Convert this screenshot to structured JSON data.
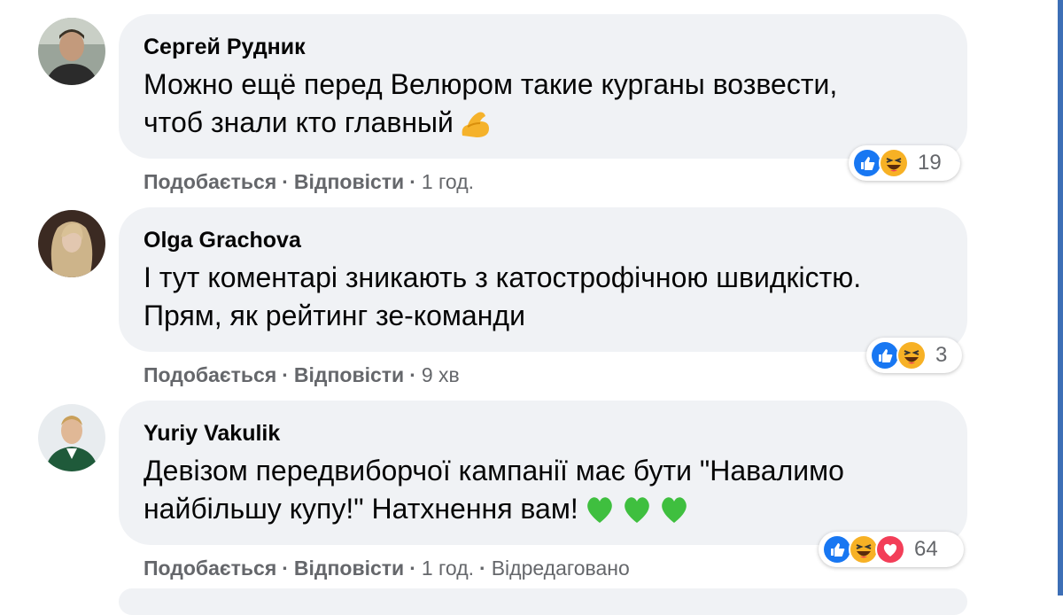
{
  "colors": {
    "bubble": "#f0f2f5",
    "meta_text": "#65676b",
    "like_blue": "#1877f2",
    "haha_yellow": "#f7b125",
    "love_red": "#f33e58",
    "frame": "#3d6fb6"
  },
  "comments": [
    {
      "author": "Сергей Рудник",
      "line1": "Можно ещё перед Велюром такие курганы возвести,",
      "line2": "чтоб знали кто главный",
      "trailing_emoji": "flexed-biceps-icon",
      "reactions": [
        "like-icon",
        "haha-icon"
      ],
      "reaction_count": "19",
      "like_label": "Подобається",
      "reply_label": "Відповісти",
      "time": "1 год.",
      "edited": ""
    },
    {
      "author": "Olga Grachova",
      "line1": "І тут коментарі зникають з катострофічною швидкістю.",
      "line2": "Прям, як рейтинг зе-команди",
      "reactions": [
        "like-icon",
        "haha-icon"
      ],
      "reaction_count": "3",
      "like_label": "Подобається",
      "reply_label": "Відповісти",
      "time": "9 хв",
      "edited": ""
    },
    {
      "author": "Yuriy Vakulik",
      "line1": "Девізом передвиборчої кампанії має бути \"Навалимо",
      "line2": "найбільшу купу!\" Натхнення вам!",
      "trailing_emoji": "green-heart-icon",
      "reactions": [
        "like-icon",
        "haha-icon",
        "love-icon"
      ],
      "reaction_count": "64",
      "like_label": "Подобається",
      "reply_label": "Відповісти",
      "time": "1 год.",
      "edited": "Відредаговано"
    }
  ],
  "separator": "·"
}
